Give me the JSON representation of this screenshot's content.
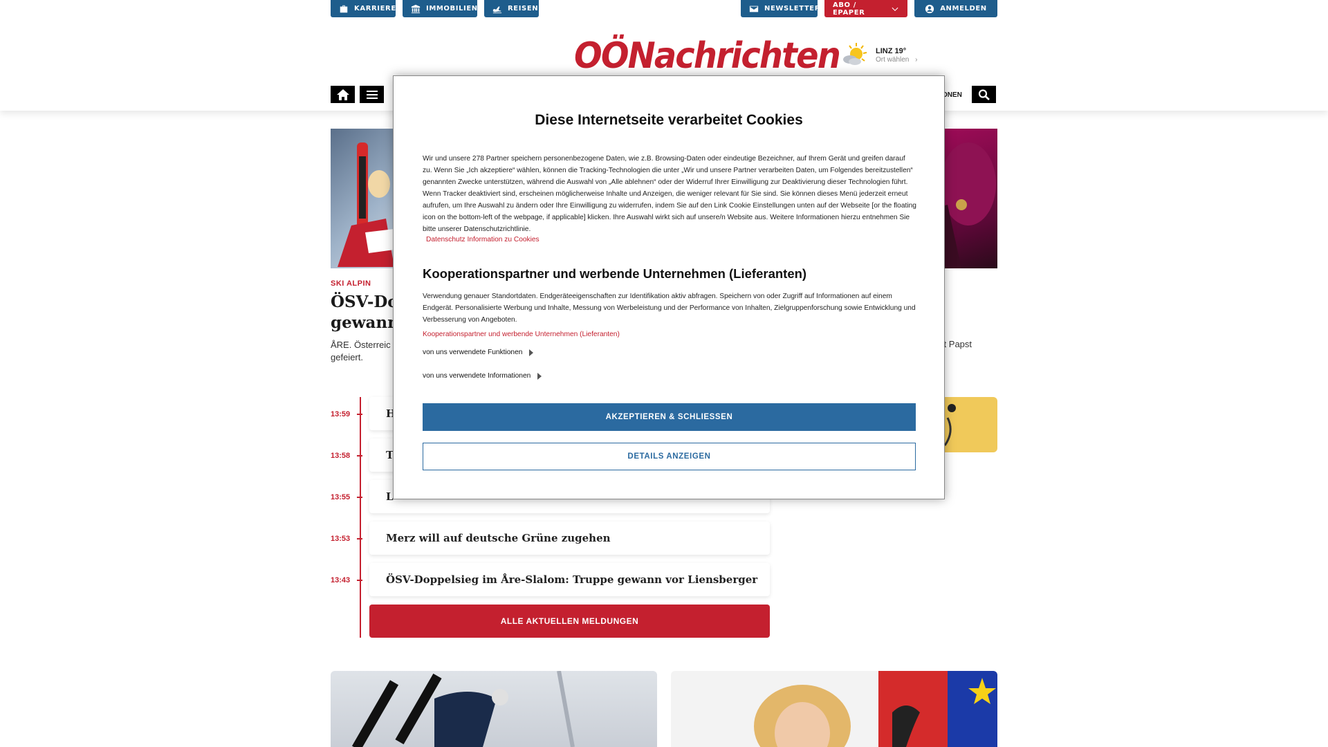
{
  "topbar": {
    "karriere": "KARRIERE",
    "immobilien": "IMMOBILIEN",
    "reisen": "REISEN",
    "newsletter": "NEWSLETTER",
    "abo": "ABO / EPAPER",
    "anmelden": "ANMELDEN"
  },
  "header": {
    "logo": "OÖNachrichten",
    "weather_city": "LINZ 19°",
    "weather_link": "Ort wählen",
    "nav_partial": "ONEN"
  },
  "hero": {
    "kicker": "SKI ALPIN",
    "title_line1": "ÖSV-Do",
    "title_line2": "gewann",
    "teaser_line1": "ÅRE. Österreic",
    "teaser_line2": "gefeiert.",
    "right_teaser": "ert Papst"
  },
  "news": [
    {
      "time": "13:59",
      "title": "H"
    },
    {
      "time": "13:58",
      "title": "T"
    },
    {
      "time": "13:55",
      "title": "L"
    },
    {
      "time": "13:53",
      "title": "Merz will auf deutsche Grüne zugehen"
    },
    {
      "time": "13:43",
      "title": "ÖSV-Doppelsieg im Åre-Slalom: Truppe gewann vor Liensberger"
    }
  ],
  "all_news_label": "ALLE AKTUELLEN MELDUNGEN",
  "cookie": {
    "title": "Diese Internetseite verarbeitet Cookies",
    "intro": "Wir und unsere 278 Partner speichern personenbezogene Daten, wie z.B. Browsing-Daten oder eindeutige Bezeichner, auf Ihrem Gerät und greifen darauf zu. Wenn Sie „Ich akzeptiere“ wählen, können die Tracking-Technologien die unter „Wir und unsere Partner verarbeiten Daten, um Folgendes bereitzustellen“ genannten Zwecke unterstützen, während die Auswahl von „Alle ablehnen“ oder der Widerruf Ihrer Einwilligung zur Deaktivierung dieser Technologien führt. Wenn Tracker deaktiviert sind, erscheinen möglicherweise Inhalte und Anzeigen, die weniger relevant für Sie sind. Sie können dieses Menü jederzeit erneut aufrufen, um Ihre Auswahl zu ändern oder Ihre Einwilligung zu widerrufen, indem Sie auf den Link Cookie Einstellungen unten auf der Webseite [or the floating icon on the bottom-left of the webpage, if applicable] klicken. Ihre Auswahl wirkt sich auf unsere/n Website aus. Weitere Informationen hierzu entnehmen Sie bitte unserer Datenschutzrichtlinie.",
    "privacy_link": "Datenschutz Information zu Cookies",
    "partners_title": "Kooperationspartner und werbende Unternehmen (Lieferanten)",
    "partners_text": "Verwendung genauer Standortdaten. Endgeräteeigenschaften zur Identifikation aktiv abfragen. Speichern von oder Zugriff auf Informationen auf einem Endgerät. Personalisierte Werbung und Inhalte, Messung von Werbeleistung und der Performance von Inhalten, Zielgruppenforschung sowie Entwicklung und Verbesserung von Angeboten.",
    "partners_link": "Kooperationspartner und werbende Unternehmen (Lieferanten)",
    "functions_label": "von uns verwendete Funktionen",
    "info_label": "von uns verwendete Informationen",
    "accept_label": "AKZEPTIEREN & SCHLIESSEN",
    "details_label": "DETAILS ANZEIGEN"
  },
  "colors": {
    "brand_red": "#c4202f",
    "brand_blue": "#1e5d8c",
    "dialog_button_blue": "#2b6aa0"
  }
}
